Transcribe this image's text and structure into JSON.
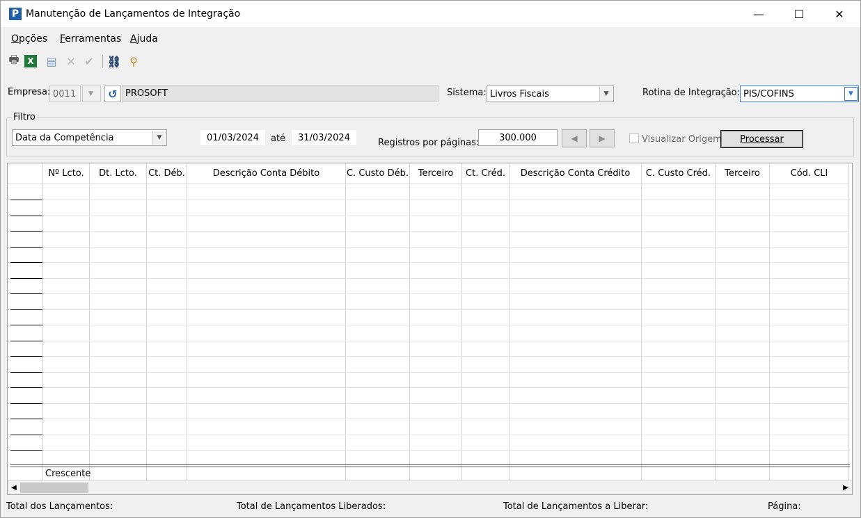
{
  "window": {
    "title": "Manutenção de Lançamentos de Integração",
    "app_icon_letter": "P",
    "minimize": "—",
    "maximize": "☐",
    "close": "✕"
  },
  "menu": {
    "items": [
      {
        "accel": "O",
        "rest": "pções"
      },
      {
        "accel": "F",
        "rest": "erramentas"
      },
      {
        "accel": "A",
        "rest": "juda"
      }
    ]
  },
  "toolbar": {
    "icons": [
      "printer-icon",
      "excel-export-icon",
      "document-icon",
      "cancel-x-icon",
      "confirm-check-icon",
      "binoculars-icon",
      "magnifier-icon"
    ],
    "glyphs": {
      "printer": "🖶",
      "excel": "X",
      "document": "▤",
      "cancel": "✕",
      "confirm": "✔",
      "binoculars": "⛓",
      "magnifier": "⚲"
    }
  },
  "company": {
    "label": "Empresa:",
    "code": "0011",
    "dropdown_glyph": "▼",
    "refresh_glyph": "↺",
    "name": "PROSOFT"
  },
  "system": {
    "label": "Sistema:",
    "value": "Livros Fiscais",
    "dropdown_glyph": "▼"
  },
  "routine": {
    "label": "Rotina de Integração:",
    "value": "PIS/COFINS",
    "dropdown_glyph": "▼"
  },
  "filter": {
    "legend": "Filtro",
    "date_type": "Data da Competência",
    "dropdown_glyph": "▼",
    "date_from": "01/03/2024",
    "until_label": "até",
    "date_to": "31/03/2024",
    "records_label": "Registros por páginas:",
    "records_value": "300.000",
    "prev_glyph": "◀",
    "next_glyph": "▶",
    "show_origin_label": "Visualizar Origem",
    "process_button": "Processar"
  },
  "grid": {
    "columns": [
      "Nº Lcto.",
      "Dt. Lcto.",
      "Ct. Déb.",
      "Descrição Conta Débito",
      "C. Custo Déb.",
      "Terceiro",
      "Ct. Créd.",
      "Descrição Conta Crédito",
      "C. Custo Créd.",
      "Terceiro",
      "Cód. CLI"
    ],
    "sort_label": "Crescente",
    "scroll_left": "◀",
    "scroll_right": "▶"
  },
  "status": {
    "total": "Total dos Lançamentos:",
    "released": "Total de Lançamentos Liberados:",
    "to_release": "Total de Lançamentos a Liberar:",
    "page": "Página:"
  }
}
